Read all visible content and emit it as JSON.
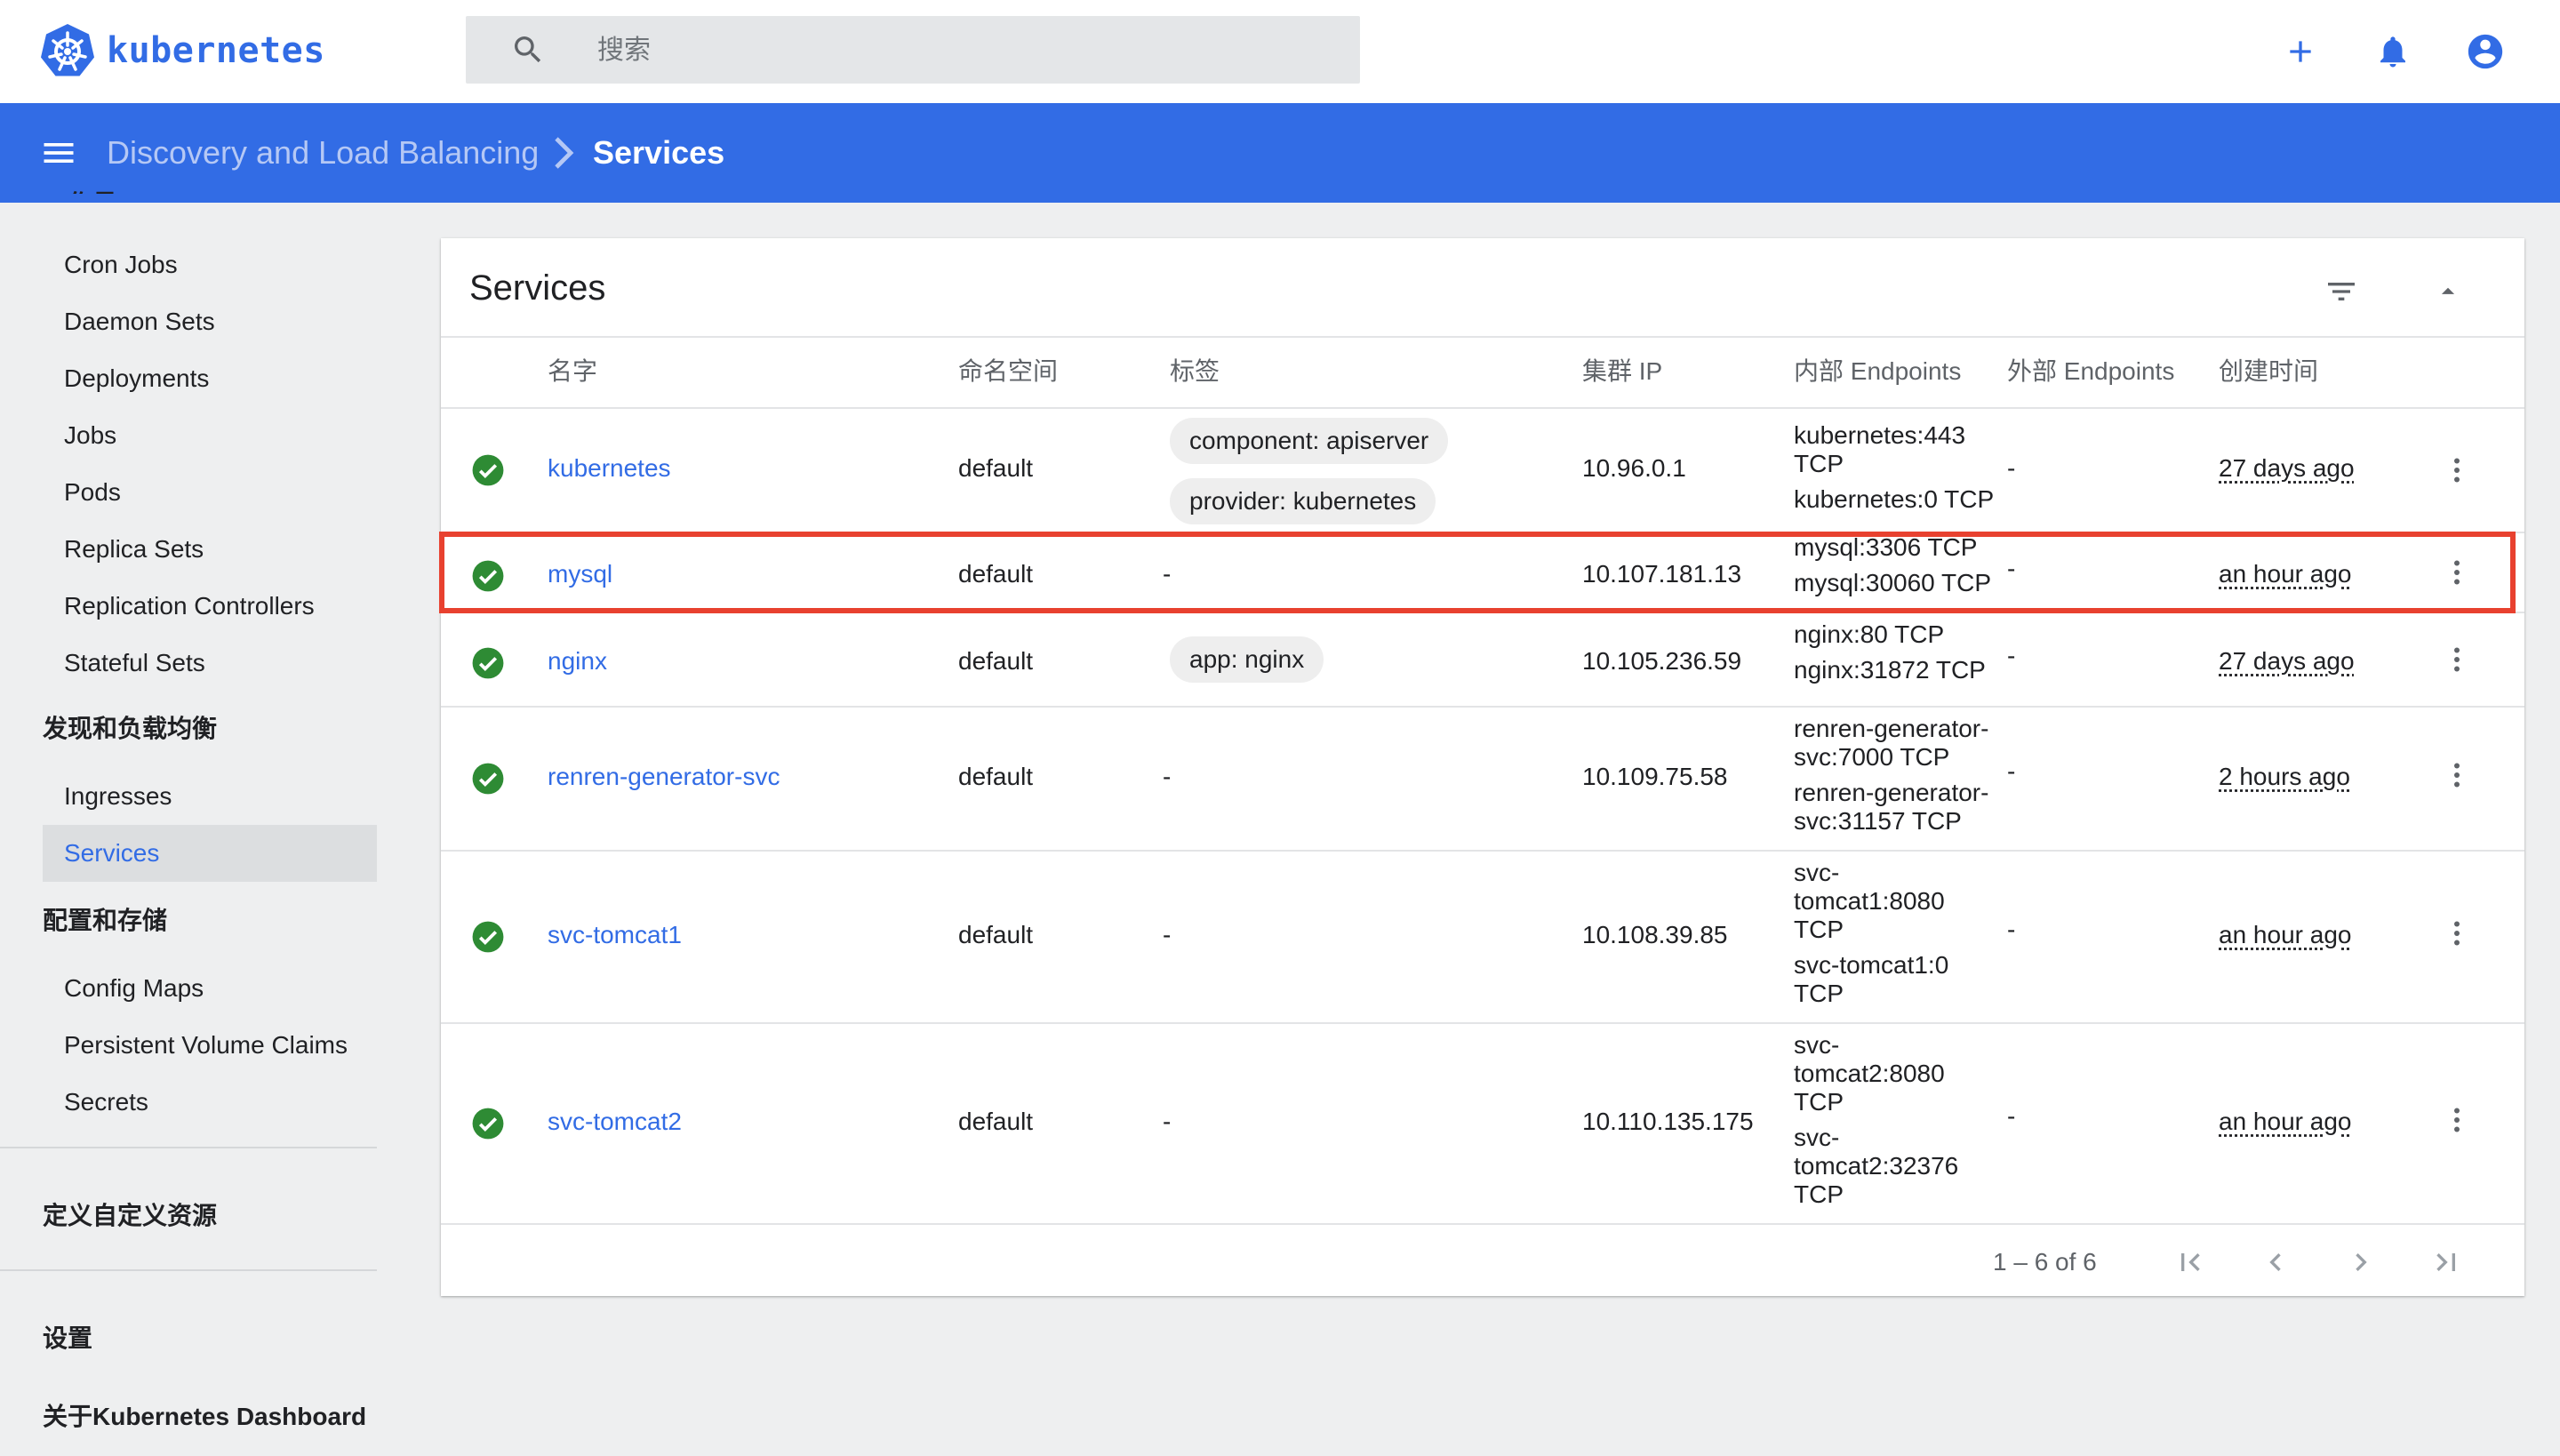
{
  "app": {
    "logo_text": "kubernetes"
  },
  "search": {
    "placeholder": "搜索"
  },
  "breadcrumb": {
    "parent": "Discovery and Load Balancing",
    "current": "Services"
  },
  "sidebar": {
    "cut_heading": "工作量",
    "workloads": [
      "Cron Jobs",
      "Daemon Sets",
      "Deployments",
      "Jobs",
      "Pods",
      "Replica Sets",
      "Replication Controllers",
      "Stateful Sets"
    ],
    "discovery_heading": "发现和负载均衡",
    "discovery": [
      "Ingresses",
      "Services"
    ],
    "config_heading": "配置和存储",
    "config": [
      "Config Maps",
      "Persistent Volume Claims",
      "Secrets"
    ],
    "crd": "定义自定义资源",
    "settings": "设置",
    "about": "关于Kubernetes Dashboard"
  },
  "card": {
    "title": "Services",
    "columns": {
      "name": "名字",
      "namespace": "命名空间",
      "labels": "标签",
      "cluster_ip": "集群 IP",
      "internal_endpoints": "内部 Endpoints",
      "external_endpoints": "外部 Endpoints",
      "created": "创建时间"
    },
    "rows": [
      {
        "name": "kubernetes",
        "namespace": "default",
        "labels": [
          "component: apiserver",
          "provider: kubernetes"
        ],
        "cluster_ip": "10.96.0.1",
        "internal": [
          "kubernetes:443",
          "TCP",
          "kubernetes:0 TCP"
        ],
        "external": "-",
        "created": "27 days ago"
      },
      {
        "name": "mysql",
        "namespace": "default",
        "labels_text": "-",
        "cluster_ip": "10.107.181.13",
        "internal": [
          "mysql:3306 TCP",
          "mysql:30060 TCP"
        ],
        "external": "-",
        "created": "an hour ago"
      },
      {
        "name": "nginx",
        "namespace": "default",
        "labels": [
          "app: nginx"
        ],
        "cluster_ip": "10.105.236.59",
        "internal": [
          "nginx:80 TCP",
          "nginx:31872 TCP"
        ],
        "external": "-",
        "created": "27 days ago"
      },
      {
        "name": "renren-generator-svc",
        "namespace": "default",
        "labels_text": "-",
        "cluster_ip": "10.109.75.58",
        "internal": [
          "renren-generator-",
          "svc:7000 TCP",
          "renren-generator-",
          "svc:31157 TCP"
        ],
        "external": "-",
        "created": "2 hours ago"
      },
      {
        "name": "svc-tomcat1",
        "namespace": "default",
        "labels_text": "-",
        "cluster_ip": "10.108.39.85",
        "internal": [
          "svc-",
          "tomcat1:8080",
          "TCP",
          "svc-tomcat1:0",
          "TCP"
        ],
        "external": "-",
        "created": "an hour ago"
      },
      {
        "name": "svc-tomcat2",
        "namespace": "default",
        "labels_text": "-",
        "cluster_ip": "10.110.135.175",
        "internal": [
          "svc-",
          "tomcat2:8080",
          "TCP",
          "svc-",
          "tomcat2:32376",
          "TCP"
        ],
        "external": "-",
        "created": "an hour ago"
      }
    ],
    "pagination": "1 – 6 of 6"
  },
  "colors": {
    "brand": "#326ce5",
    "ok": "#2e8b34",
    "highlight": "#e8412f"
  },
  "icons": [
    "kubernetes-logo-icon",
    "search-icon",
    "add-icon",
    "bell-icon",
    "account-icon",
    "menu-icon",
    "chevron-right-icon",
    "filter-icon",
    "arrow-up-icon",
    "check-circle-icon",
    "more-vert-icon",
    "first-page-icon",
    "prev-page-icon",
    "next-page-icon",
    "last-page-icon"
  ]
}
